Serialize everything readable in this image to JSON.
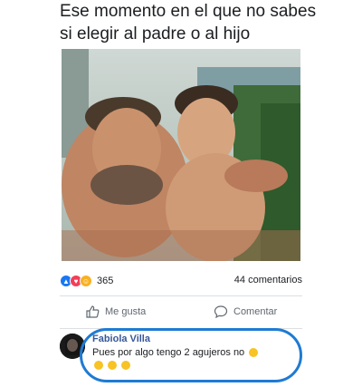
{
  "post": {
    "caption_line1": "Ese momento en el que no sabes",
    "caption_line2": "si elegir al padre o al hijo"
  },
  "stats": {
    "reaction_count": "365",
    "comments_label": "44 comentarios"
  },
  "actions": {
    "like_label": "Me gusta",
    "comment_label": "Comentar"
  },
  "comment": {
    "author": "Fabiola Villa",
    "text": "Pues por algo tengo 2 agujeros no"
  },
  "colors": {
    "like_blue": "#1877f2",
    "highlight": "#1e7bd3",
    "author_link": "#365899"
  }
}
